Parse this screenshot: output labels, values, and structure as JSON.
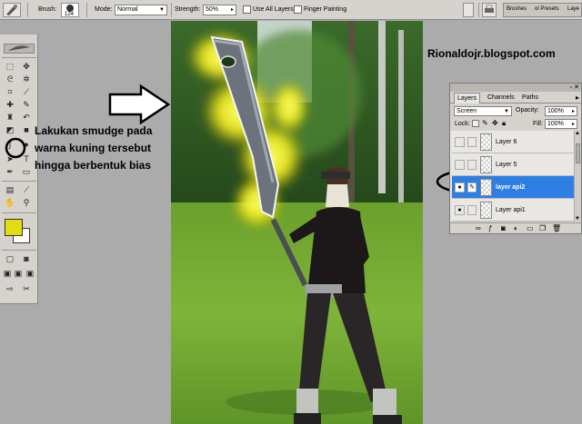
{
  "options_bar": {
    "brush_label": "Brush:",
    "brush_size": "124",
    "mode_label": "Mode:",
    "mode_value": "Normal",
    "strength_label": "Strength:",
    "strength_value": "50%",
    "use_all_layers_label": "Use All Layers",
    "finger_painting_label": "Finger Painting",
    "palette_well_tabs": [
      "Brushes",
      "ol Presets",
      "Laye"
    ]
  },
  "layers_panel": {
    "tabs": [
      "Layers",
      "Channels",
      "Paths"
    ],
    "active_tab": "Layers",
    "blend_mode": "Screen",
    "opacity_label": "Opacity:",
    "opacity_value": "100%",
    "lock_label": "Lock:",
    "fill_label": "Fill:",
    "fill_value": "100%",
    "layers": [
      {
        "name": "Layer 6",
        "visible": false,
        "selected": false
      },
      {
        "name": "Layer 5",
        "visible": false,
        "selected": false
      },
      {
        "name": "layer api2",
        "visible": true,
        "selected": true
      },
      {
        "name": "Layer api1",
        "visible": true,
        "selected": false
      }
    ]
  },
  "tools_panel": {
    "foreground_color": "#e2dc12",
    "background_color": "#ffffff"
  },
  "annotation": {
    "lines": [
      "Lakukan smudge pada",
      "warna kuning tersebut",
      "hingga berbentuk bias"
    ],
    "watermark": "Rionaldojr.blogspot.com"
  },
  "colors": {
    "selection_blue": "#2d7fe3",
    "panel_gray": "#d6d3ce",
    "glow_yellow": "#f3ee1a"
  }
}
